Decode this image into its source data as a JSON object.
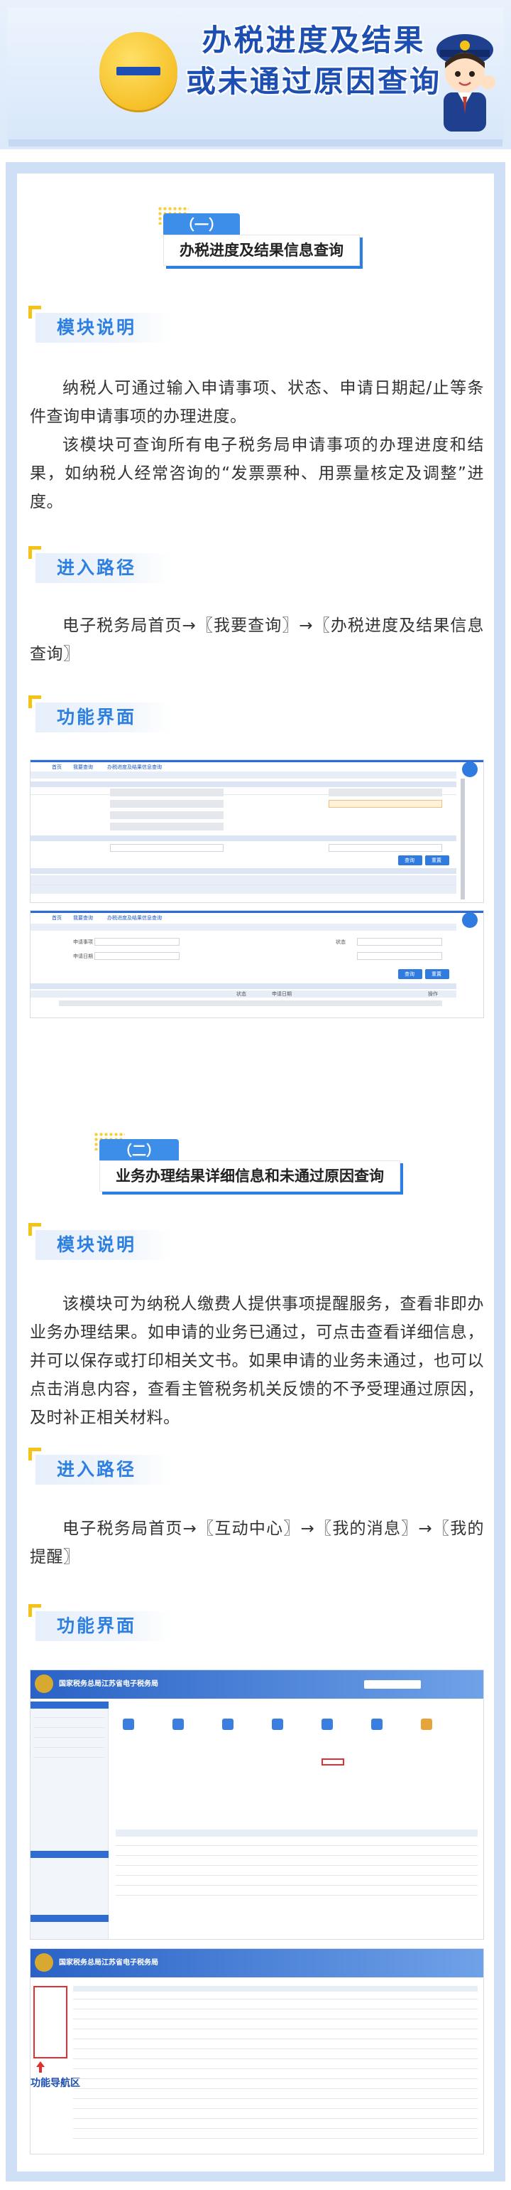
{
  "banner": {
    "number_char": "一",
    "title_line1": "办税进度及结果",
    "title_line2": "或未通过原因查询",
    "mascot_icon": "tax-officer-mascot-icon"
  },
  "section1": {
    "tab": "（一）",
    "title": "办税进度及结果信息查询",
    "module_label": "模块说明",
    "module_p1": "纳税人可通过输入申请事项、状态、申请日期起/止等条件查询申请事项的办理进度。",
    "module_p2": "该模块可查询所有电子税务局申请事项的办理进度和结果，如纳税人经常咨询的“发票票种、用票量核定及调整”进度。",
    "path_label": "进入路径",
    "path_text": "电子税务局首页→〖我要查询〗→〖办税进度及结果信息查询〗",
    "ui_label": "功能界面"
  },
  "section2": {
    "tab": "（二）",
    "title": "业务办理结果详细信息和未通过原因查询",
    "module_label": "模块说明",
    "module_p1": "该模块可为纳税人缴费人提供事项提醒服务，查看非即办业务办理结果。如申请的业务已通过，可点击查看详细信息，并可以保存或打印相关文书。如果申请的业务未通过，也可以点击消息内容，查看主管税务机关反馈的不予受理通过原因，及时补正相关材料。",
    "path_label": "进入路径",
    "path_text": "电子税务局首页→〖互动中心〗→〖我的消息〗→〖我的提醒〗",
    "ui_label": "功能界面",
    "nav_callout": "功能导航区"
  },
  "shots": {
    "portal_title": "国家税务总局江苏省电子税务局",
    "crumb_home": "首页",
    "crumb_query": "我要查询",
    "crumb_progress": "办税进度及结果信息查询",
    "query_btn": "查询",
    "reset_btn": "重置",
    "col_apply_item": "申请事项",
    "col_status": "状态",
    "col_apply_date": "申请日期",
    "col_op": "操作"
  },
  "colors": {
    "brand_blue": "#2d7fe0",
    "title_blue": "#1d4fb3",
    "accent_yellow": "#f5c218"
  }
}
